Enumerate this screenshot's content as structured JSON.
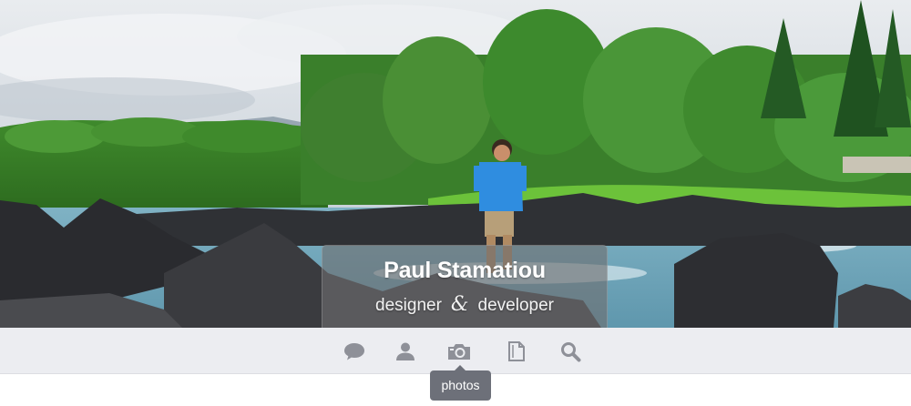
{
  "profile": {
    "name": "Paul Stamatiou",
    "role_left": "designer",
    "ampersand": "&",
    "role_right": "developer"
  },
  "nav": {
    "items": [
      {
        "icon": "chat-bubble-icon"
      },
      {
        "icon": "user-icon"
      },
      {
        "icon": "camera-icon",
        "active": true
      },
      {
        "icon": "document-icon"
      },
      {
        "icon": "search-icon"
      }
    ],
    "tooltip": "photos"
  },
  "colors": {
    "nav_background": "#ecedf1",
    "icon_color": "#8e9098",
    "tooltip_background": "#6d7079",
    "card_overlay": "#6e6e70"
  }
}
